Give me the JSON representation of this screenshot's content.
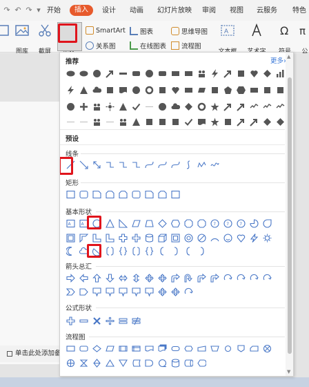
{
  "menu": {
    "tabs": [
      {
        "label": "开始",
        "active": false
      },
      {
        "label": "插入",
        "active": true
      },
      {
        "label": "设计",
        "active": false
      },
      {
        "label": "动画",
        "active": false
      },
      {
        "label": "幻灯片放映",
        "active": false
      },
      {
        "label": "审阅",
        "active": false
      },
      {
        "label": "视图",
        "active": false
      },
      {
        "label": "云服务",
        "active": false
      },
      {
        "label": "特色",
        "active": false
      }
    ],
    "accent": "#e75a2c"
  },
  "ribbon": {
    "picture_label": "图库",
    "screenshot_label": "截屏",
    "shape_label": "形状",
    "smartart_label": "SmartArt",
    "chart_label": "图表",
    "relation_label": "关系图",
    "online_chart_label": "在线图表",
    "mindmap_label": "思维导图",
    "flowchart_label": "流程图",
    "textbox_label": "文本框",
    "arttext_label": "艺术字",
    "symbol_label": "符号",
    "formula_label": "公"
  },
  "panel": {
    "recommended_title": "推荐",
    "more_label": "更多»",
    "preset_title": "预设",
    "sections": [
      {
        "key": "lines",
        "title": "线条"
      },
      {
        "key": "rect",
        "title": "矩形"
      },
      {
        "key": "basic",
        "title": "基本形状"
      },
      {
        "key": "arrows",
        "title": "箭头总汇"
      },
      {
        "key": "formula",
        "title": "公式形状"
      },
      {
        "key": "flow",
        "title": "流程图"
      }
    ]
  },
  "doc": {
    "notes_placeholder": "单击此处添加备注"
  },
  "colors": {
    "highlight": "#e0141c",
    "shape_stroke": "#4a78c7",
    "recommended_fill": "#555555"
  }
}
